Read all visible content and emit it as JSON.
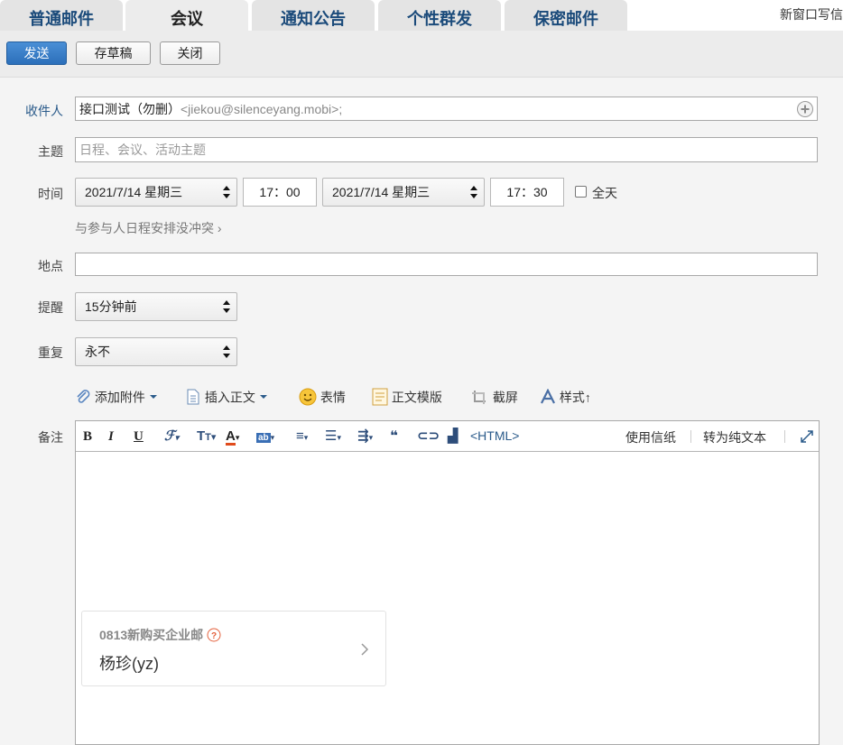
{
  "tabs": [
    {
      "label": "普通邮件"
    },
    {
      "label": "会议"
    },
    {
      "label": "通知公告"
    },
    {
      "label": "个性群发"
    },
    {
      "label": "保密邮件"
    }
  ],
  "new_window": "新窗口写信",
  "toolbar": {
    "send": "发送",
    "draft": "存草稿",
    "close": "关闭"
  },
  "form": {
    "recipients_label": "收件人",
    "recipient_name": "接口测试（勿删）",
    "recipient_addr": "<jiekou@silenceyang.mobi>;",
    "subject_label": "主题",
    "subject_placeholder": "日程、会议、活动主题",
    "time_label": "时间",
    "start_date": "2021/7/14 星期三",
    "start_time": "17：00",
    "end_date": "2021/7/14 星期三",
    "end_time": "17：30",
    "all_day": "全天",
    "conflict_hint": "与参与人日程安排没冲突 ›",
    "location_label": "地点",
    "remind_label": "提醒",
    "remind_value": "15分钟前",
    "repeat_label": "重复",
    "repeat_value": "永不",
    "notes_label": "备注"
  },
  "attach_bar": {
    "add_attachment": "添加附件",
    "insert_body": "插入正文",
    "emoji": "表情",
    "template": "正文模版",
    "screenshot": "截屏",
    "style": "样式↑"
  },
  "editor": {
    "html_label": "<HTML>",
    "use_stationery": "使用信纸",
    "plain_text": "转为纯文本"
  },
  "signature_card": {
    "title": "0813新购买企业邮",
    "name": "杨珍(yz)"
  }
}
